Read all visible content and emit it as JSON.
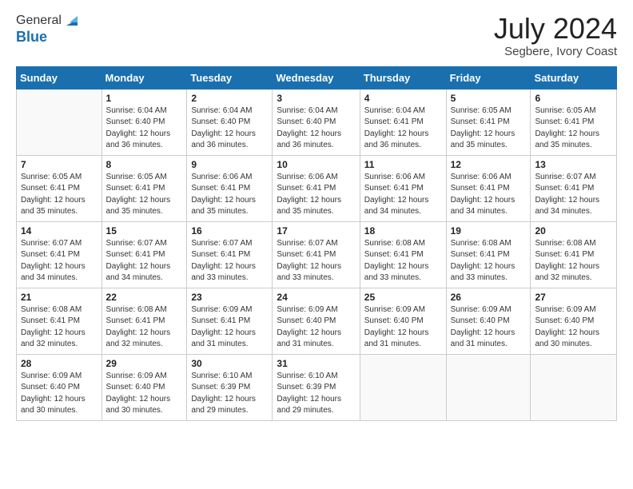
{
  "header": {
    "logo": {
      "line1": "General",
      "line2": "Blue"
    },
    "title": "July 2024",
    "location": "Segbere, Ivory Coast"
  },
  "calendar": {
    "days_of_week": [
      "Sunday",
      "Monday",
      "Tuesday",
      "Wednesday",
      "Thursday",
      "Friday",
      "Saturday"
    ],
    "weeks": [
      [
        {
          "day": null,
          "sunrise": null,
          "sunset": null,
          "daylight": null
        },
        {
          "day": "1",
          "sunrise": "Sunrise: 6:04 AM",
          "sunset": "Sunset: 6:40 PM",
          "daylight": "Daylight: 12 hours and 36 minutes."
        },
        {
          "day": "2",
          "sunrise": "Sunrise: 6:04 AM",
          "sunset": "Sunset: 6:40 PM",
          "daylight": "Daylight: 12 hours and 36 minutes."
        },
        {
          "day": "3",
          "sunrise": "Sunrise: 6:04 AM",
          "sunset": "Sunset: 6:40 PM",
          "daylight": "Daylight: 12 hours and 36 minutes."
        },
        {
          "day": "4",
          "sunrise": "Sunrise: 6:04 AM",
          "sunset": "Sunset: 6:41 PM",
          "daylight": "Daylight: 12 hours and 36 minutes."
        },
        {
          "day": "5",
          "sunrise": "Sunrise: 6:05 AM",
          "sunset": "Sunset: 6:41 PM",
          "daylight": "Daylight: 12 hours and 35 minutes."
        },
        {
          "day": "6",
          "sunrise": "Sunrise: 6:05 AM",
          "sunset": "Sunset: 6:41 PM",
          "daylight": "Daylight: 12 hours and 35 minutes."
        }
      ],
      [
        {
          "day": "7",
          "sunrise": "Sunrise: 6:05 AM",
          "sunset": "Sunset: 6:41 PM",
          "daylight": "Daylight: 12 hours and 35 minutes."
        },
        {
          "day": "8",
          "sunrise": "Sunrise: 6:05 AM",
          "sunset": "Sunset: 6:41 PM",
          "daylight": "Daylight: 12 hours and 35 minutes."
        },
        {
          "day": "9",
          "sunrise": "Sunrise: 6:06 AM",
          "sunset": "Sunset: 6:41 PM",
          "daylight": "Daylight: 12 hours and 35 minutes."
        },
        {
          "day": "10",
          "sunrise": "Sunrise: 6:06 AM",
          "sunset": "Sunset: 6:41 PM",
          "daylight": "Daylight: 12 hours and 35 minutes."
        },
        {
          "day": "11",
          "sunrise": "Sunrise: 6:06 AM",
          "sunset": "Sunset: 6:41 PM",
          "daylight": "Daylight: 12 hours and 34 minutes."
        },
        {
          "day": "12",
          "sunrise": "Sunrise: 6:06 AM",
          "sunset": "Sunset: 6:41 PM",
          "daylight": "Daylight: 12 hours and 34 minutes."
        },
        {
          "day": "13",
          "sunrise": "Sunrise: 6:07 AM",
          "sunset": "Sunset: 6:41 PM",
          "daylight": "Daylight: 12 hours and 34 minutes."
        }
      ],
      [
        {
          "day": "14",
          "sunrise": "Sunrise: 6:07 AM",
          "sunset": "Sunset: 6:41 PM",
          "daylight": "Daylight: 12 hours and 34 minutes."
        },
        {
          "day": "15",
          "sunrise": "Sunrise: 6:07 AM",
          "sunset": "Sunset: 6:41 PM",
          "daylight": "Daylight: 12 hours and 34 minutes."
        },
        {
          "day": "16",
          "sunrise": "Sunrise: 6:07 AM",
          "sunset": "Sunset: 6:41 PM",
          "daylight": "Daylight: 12 hours and 33 minutes."
        },
        {
          "day": "17",
          "sunrise": "Sunrise: 6:07 AM",
          "sunset": "Sunset: 6:41 PM",
          "daylight": "Daylight: 12 hours and 33 minutes."
        },
        {
          "day": "18",
          "sunrise": "Sunrise: 6:08 AM",
          "sunset": "Sunset: 6:41 PM",
          "daylight": "Daylight: 12 hours and 33 minutes."
        },
        {
          "day": "19",
          "sunrise": "Sunrise: 6:08 AM",
          "sunset": "Sunset: 6:41 PM",
          "daylight": "Daylight: 12 hours and 33 minutes."
        },
        {
          "day": "20",
          "sunrise": "Sunrise: 6:08 AM",
          "sunset": "Sunset: 6:41 PM",
          "daylight": "Daylight: 12 hours and 32 minutes."
        }
      ],
      [
        {
          "day": "21",
          "sunrise": "Sunrise: 6:08 AM",
          "sunset": "Sunset: 6:41 PM",
          "daylight": "Daylight: 12 hours and 32 minutes."
        },
        {
          "day": "22",
          "sunrise": "Sunrise: 6:08 AM",
          "sunset": "Sunset: 6:41 PM",
          "daylight": "Daylight: 12 hours and 32 minutes."
        },
        {
          "day": "23",
          "sunrise": "Sunrise: 6:09 AM",
          "sunset": "Sunset: 6:41 PM",
          "daylight": "Daylight: 12 hours and 31 minutes."
        },
        {
          "day": "24",
          "sunrise": "Sunrise: 6:09 AM",
          "sunset": "Sunset: 6:40 PM",
          "daylight": "Daylight: 12 hours and 31 minutes."
        },
        {
          "day": "25",
          "sunrise": "Sunrise: 6:09 AM",
          "sunset": "Sunset: 6:40 PM",
          "daylight": "Daylight: 12 hours and 31 minutes."
        },
        {
          "day": "26",
          "sunrise": "Sunrise: 6:09 AM",
          "sunset": "Sunset: 6:40 PM",
          "daylight": "Daylight: 12 hours and 31 minutes."
        },
        {
          "day": "27",
          "sunrise": "Sunrise: 6:09 AM",
          "sunset": "Sunset: 6:40 PM",
          "daylight": "Daylight: 12 hours and 30 minutes."
        }
      ],
      [
        {
          "day": "28",
          "sunrise": "Sunrise: 6:09 AM",
          "sunset": "Sunset: 6:40 PM",
          "daylight": "Daylight: 12 hours and 30 minutes."
        },
        {
          "day": "29",
          "sunrise": "Sunrise: 6:09 AM",
          "sunset": "Sunset: 6:40 PM",
          "daylight": "Daylight: 12 hours and 30 minutes."
        },
        {
          "day": "30",
          "sunrise": "Sunrise: 6:10 AM",
          "sunset": "Sunset: 6:39 PM",
          "daylight": "Daylight: 12 hours and 29 minutes."
        },
        {
          "day": "31",
          "sunrise": "Sunrise: 6:10 AM",
          "sunset": "Sunset: 6:39 PM",
          "daylight": "Daylight: 12 hours and 29 minutes."
        },
        {
          "day": null,
          "sunrise": null,
          "sunset": null,
          "daylight": null
        },
        {
          "day": null,
          "sunrise": null,
          "sunset": null,
          "daylight": null
        },
        {
          "day": null,
          "sunrise": null,
          "sunset": null,
          "daylight": null
        }
      ]
    ]
  }
}
